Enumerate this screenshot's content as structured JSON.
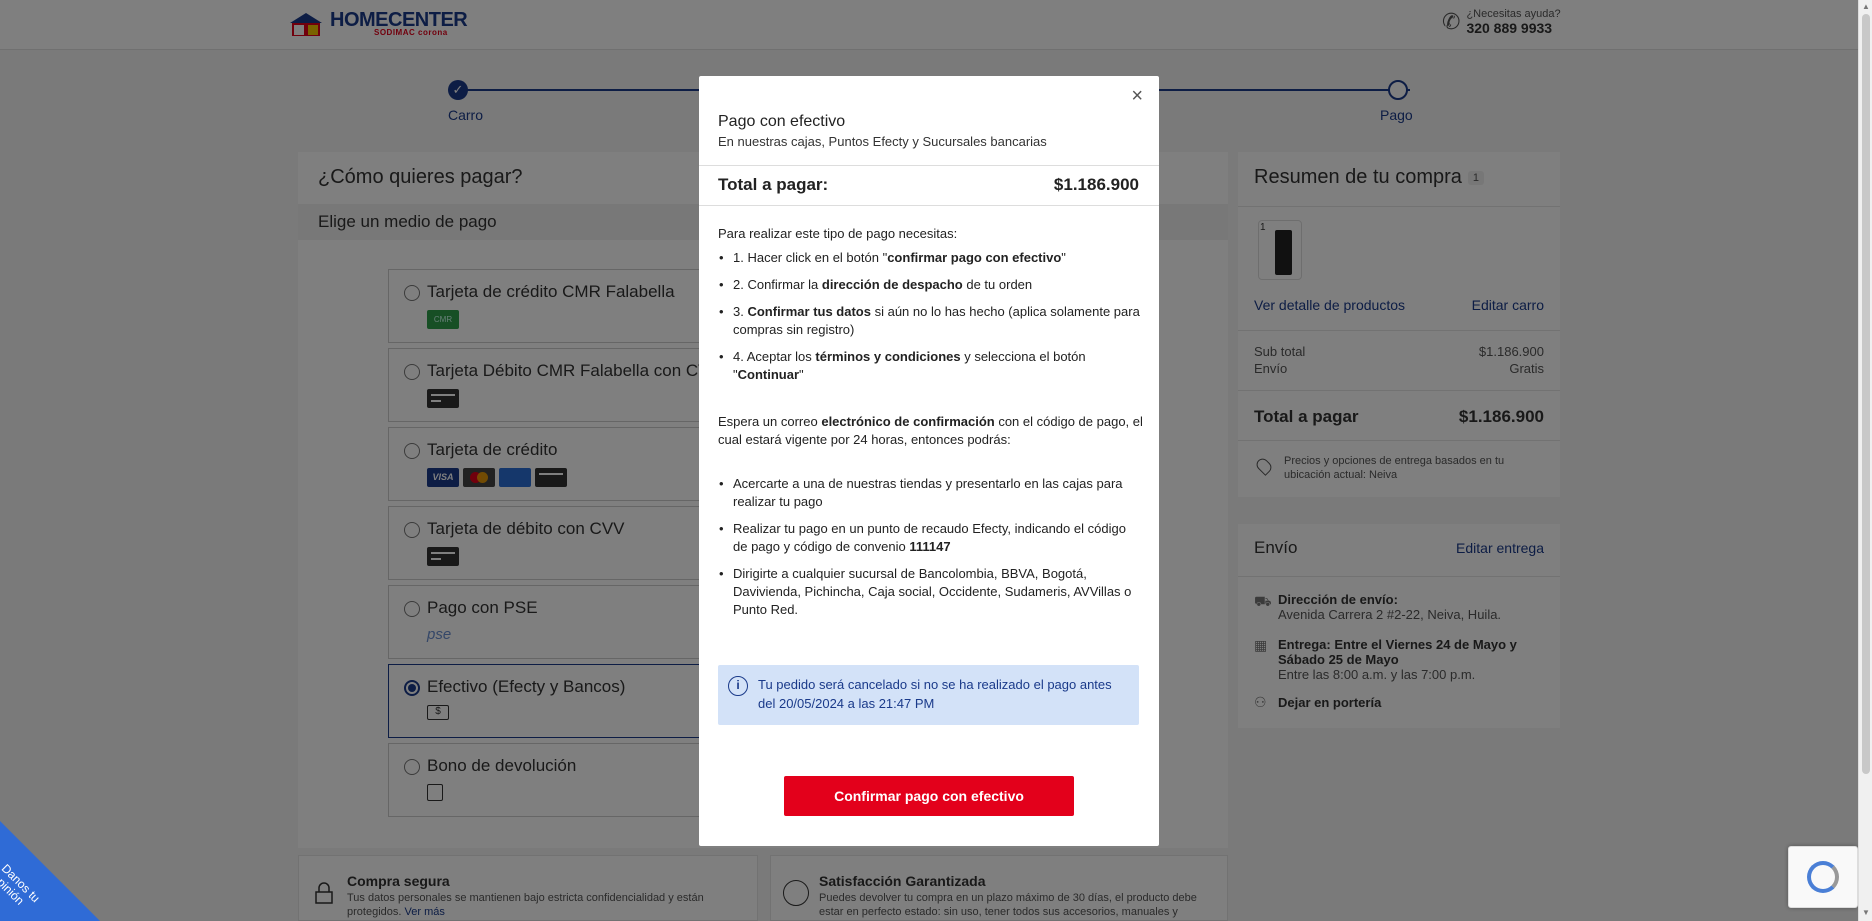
{
  "header": {
    "logo_text": "HOMECENTER",
    "logo_sub": "SODIMAC corona",
    "help_label": "¿Necesitas ayuda?",
    "help_phone": "320 889 9933"
  },
  "stepper": {
    "step1": "Carro",
    "step2": "Pago"
  },
  "payment": {
    "title": "¿Cómo quieres pagar?",
    "subtitle": "Elige un medio de pago",
    "methods": [
      {
        "label": "Tarjeta de crédito CMR Falabella"
      },
      {
        "label": "Tarjeta Débito CMR Falabella con CVV"
      },
      {
        "label": "Tarjeta de crédito"
      },
      {
        "label": "Tarjeta de débito con CVV"
      },
      {
        "label": "Pago con PSE"
      },
      {
        "label": "Efectivo (Efecty y Bancos)",
        "selected": true
      },
      {
        "label": "Bono de devolución"
      }
    ],
    "pse_text": "pse",
    "cmr_text": "CMR"
  },
  "info": {
    "secure_title": "Compra segura",
    "secure_text": "Tus datos personales se mantienen bajo estricta confidencialidad y están protegidos.",
    "secure_link": "Ver más",
    "guarantee_title": "Satisfacción Garantizada",
    "guarantee_text": "Puedes devolver tu compra en un plazo máximo de 30 días, el producto debe estar en perfecto estado: sin uso, tener todos sus accesorios, manuales y"
  },
  "summary": {
    "title": "Resumen de tu compra",
    "count": "1",
    "product_qty": "1",
    "detail_link": "Ver detalle de productos",
    "edit_cart_link": "Editar carro",
    "subtotal_label": "Sub total",
    "subtotal_value": "$1.186.900",
    "shipping_label": "Envío",
    "shipping_value": "Gratis",
    "total_label": "Total a pagar",
    "total_value": "$1.186.900",
    "note": "Precios y opciones de entrega basados en tu ubicación actual: Neiva"
  },
  "envio": {
    "title": "Envío",
    "edit_link": "Editar entrega",
    "address_label": "Dirección de envío:",
    "address_value": "Avenida Carrera 2 #2-22, Neiva, Huila.",
    "delivery_label": "Entrega: Entre el Viernes 24 de Mayo y Sábado 25 de Mayo",
    "delivery_hours": "Entre las 8:00 a.m. y las 7:00 p.m.",
    "leave_label": "Dejar en portería"
  },
  "feedback": {
    "label": "Danos tu opinión"
  },
  "modal": {
    "close": "×",
    "title": "Pago con efectivo",
    "subtitle": "En nuestras cajas, Puntos Efecty y Sucursales bancarias",
    "total_label": "Total a pagar:",
    "total_value": "$1.186.900",
    "intro": "Para realizar este tipo de pago necesitas:",
    "step1_a": "1. Hacer click en el botón \"",
    "step1_b": "confirmar pago con efectivo",
    "step1_c": "\"",
    "step2_a": "2. Confirmar la ",
    "step2_b": "dirección de despacho",
    "step2_c": " de tu orden",
    "step3_a": "3. ",
    "step3_b": "Confirmar tus datos",
    "step3_c": " si aún no lo has hecho (aplica solamente para compras sin registro)",
    "step4_a": "4. Aceptar los ",
    "step4_b": "términos y condiciones",
    "step4_c": " y selecciona el botón \"",
    "step4_d": "Continuar",
    "step4_e": "\"",
    "email_a": "Espera un correo ",
    "email_b": "electrónico de confirmación",
    "email_c": " con el código de pago, el cual estará vigente por 24 horas, entonces podrás:",
    "opt1": "Acercarte a una de nuestras tiendas y presentarlo en las cajas para realizar tu pago",
    "opt2_a": "Realizar tu pago en un punto de recaudo Efecty, indicando el código de pago y código de convenio ",
    "opt2_b": "111147",
    "opt3": "Dirigirte a cualquier sucursal de Bancolombia, BBVA, Bogotá, Davivienda, Pichincha, Caja social, Occidente, Sudameris, AVVillas o Punto Red.",
    "alert": "Tu pedido será cancelado si no se ha realizado el pago antes del 20/05/2024 a las 21:47 PM",
    "alert_icon": "i",
    "confirm_button": "Confirmar pago con efectivo"
  },
  "colors": {
    "brand_blue": "#1a3a8a",
    "brand_red": "#e3001b",
    "alert_bg": "#d3e2f8"
  }
}
